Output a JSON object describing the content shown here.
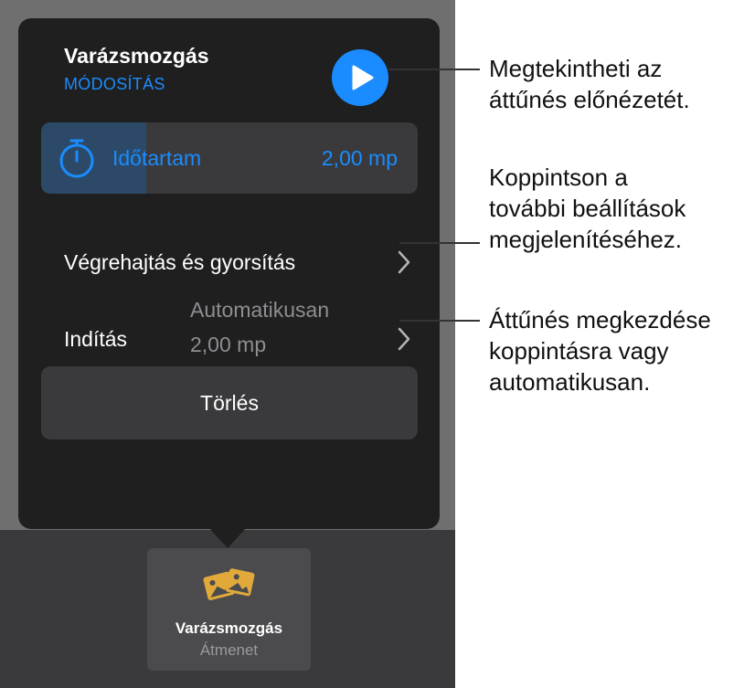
{
  "popover": {
    "title": "Varázsmozgás",
    "subtitle": "MÓDOSÍTÁS",
    "duration": {
      "label": "Időtartam",
      "value": "2,00 mp",
      "fill_fraction": 0.28
    },
    "execution_row": {
      "label": "Végrehajtás és gyorsítás"
    },
    "start_row": {
      "label": "Indítás",
      "value_line1": "Automatikusan",
      "value_line2": "2,00 mp"
    },
    "delete_label": "Törlés"
  },
  "tile": {
    "label": "Varázsmozgás",
    "sublabel": "Átmenet",
    "icon": "photos-icon"
  },
  "callouts": {
    "preview": [
      "Megtekintheti az",
      "áttűnés előnézetét."
    ],
    "options": [
      "Koppintson a",
      "további beállítások",
      "megjelenítéséhez."
    ],
    "start": [
      "Áttűnés megkezdése",
      "koppintásra vagy",
      "automatikusan."
    ]
  },
  "colors": {
    "accent": "#1a8cff",
    "panel": "#1f1f1f",
    "row": "#3a3a3c",
    "tile_icon": "#e0a93a"
  }
}
